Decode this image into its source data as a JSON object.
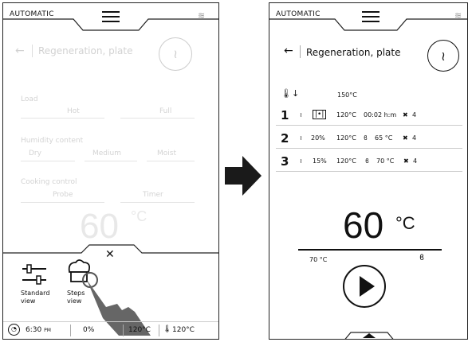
{
  "left": {
    "mode": "AUTOMATIC",
    "title": "Regeneration, plate",
    "load": {
      "label": "Load",
      "options": [
        "Hot",
        "Full"
      ]
    },
    "humidity": {
      "label": "Humidity content",
      "options": [
        "Dry",
        "Medium",
        "Moist"
      ]
    },
    "control": {
      "label": "Cooking control",
      "options": [
        "Probe",
        "Timer"
      ]
    },
    "temp": "60",
    "unit": "°C",
    "standard_view": "Standard view",
    "steps_view": "Steps view",
    "status": {
      "time": "6:30",
      "ampm": "PM",
      "percent": "0%",
      "temp1": "120°C",
      "temp2": "120°C"
    }
  },
  "right": {
    "mode": "AUTOMATIC",
    "title": "Regeneration, plate",
    "preheat": "150°C",
    "steps": [
      {
        "num": "1",
        "hum": "",
        "temp": "120°C",
        "detail": "00:02 h:m",
        "fan": "4"
      },
      {
        "num": "2",
        "hum": "20%",
        "temp": "120°C",
        "detail": "65 °C",
        "fan": "4"
      },
      {
        "num": "3",
        "hum": "15%",
        "temp": "120°C",
        "detail": "70 °C",
        "fan": "4"
      }
    ],
    "temp": "60",
    "unit": "°C",
    "probe_temp": "70 °C"
  }
}
